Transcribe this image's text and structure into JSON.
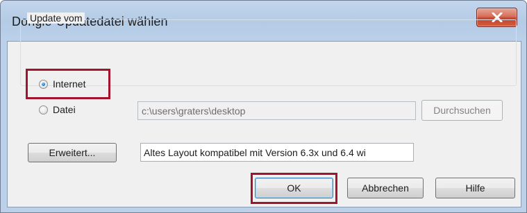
{
  "dialog": {
    "title": "Dongle-Updatedatei wählen"
  },
  "update_group": {
    "label": "Update vom",
    "options": [
      {
        "label": "Internet",
        "checked": true
      },
      {
        "label": "Datei",
        "checked": false
      }
    ],
    "file_path": "c:\\users\\graters\\desktop",
    "browse_label": "Durchsuchen"
  },
  "advanced": {
    "button_label": "Erweitert...",
    "info_text": "Altes Layout kompatibel mit Version 6.3x und 6.4 wi"
  },
  "footer": {
    "ok_label": "OK",
    "cancel_label": "Abbrechen",
    "help_label": "Hilfe"
  },
  "colors": {
    "highlight": "#a0142d",
    "close_button": "#c5432c"
  },
  "icons": {
    "close": "close-icon"
  }
}
